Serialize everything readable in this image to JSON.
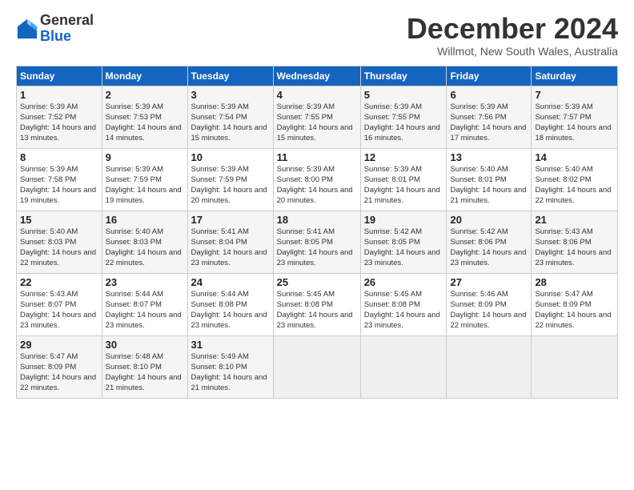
{
  "logo": {
    "general": "General",
    "blue": "Blue"
  },
  "header": {
    "title": "December 2024",
    "subtitle": "Willmot, New South Wales, Australia"
  },
  "weekdays": [
    "Sunday",
    "Monday",
    "Tuesday",
    "Wednesday",
    "Thursday",
    "Friday",
    "Saturday"
  ],
  "weeks": [
    [
      {
        "day": "1",
        "sunrise": "5:39 AM",
        "sunset": "7:52 PM",
        "daylight": "14 hours and 13 minutes."
      },
      {
        "day": "2",
        "sunrise": "5:39 AM",
        "sunset": "7:53 PM",
        "daylight": "14 hours and 14 minutes."
      },
      {
        "day": "3",
        "sunrise": "5:39 AM",
        "sunset": "7:54 PM",
        "daylight": "14 hours and 15 minutes."
      },
      {
        "day": "4",
        "sunrise": "5:39 AM",
        "sunset": "7:55 PM",
        "daylight": "14 hours and 15 minutes."
      },
      {
        "day": "5",
        "sunrise": "5:39 AM",
        "sunset": "7:55 PM",
        "daylight": "14 hours and 16 minutes."
      },
      {
        "day": "6",
        "sunrise": "5:39 AM",
        "sunset": "7:56 PM",
        "daylight": "14 hours and 17 minutes."
      },
      {
        "day": "7",
        "sunrise": "5:39 AM",
        "sunset": "7:57 PM",
        "daylight": "14 hours and 18 minutes."
      }
    ],
    [
      {
        "day": "8",
        "sunrise": "5:39 AM",
        "sunset": "7:58 PM",
        "daylight": "14 hours and 19 minutes."
      },
      {
        "day": "9",
        "sunrise": "5:39 AM",
        "sunset": "7:59 PM",
        "daylight": "14 hours and 19 minutes."
      },
      {
        "day": "10",
        "sunrise": "5:39 AM",
        "sunset": "7:59 PM",
        "daylight": "14 hours and 20 minutes."
      },
      {
        "day": "11",
        "sunrise": "5:39 AM",
        "sunset": "8:00 PM",
        "daylight": "14 hours and 20 minutes."
      },
      {
        "day": "12",
        "sunrise": "5:39 AM",
        "sunset": "8:01 PM",
        "daylight": "14 hours and 21 minutes."
      },
      {
        "day": "13",
        "sunrise": "5:40 AM",
        "sunset": "8:01 PM",
        "daylight": "14 hours and 21 minutes."
      },
      {
        "day": "14",
        "sunrise": "5:40 AM",
        "sunset": "8:02 PM",
        "daylight": "14 hours and 22 minutes."
      }
    ],
    [
      {
        "day": "15",
        "sunrise": "5:40 AM",
        "sunset": "8:03 PM",
        "daylight": "14 hours and 22 minutes."
      },
      {
        "day": "16",
        "sunrise": "5:40 AM",
        "sunset": "8:03 PM",
        "daylight": "14 hours and 22 minutes."
      },
      {
        "day": "17",
        "sunrise": "5:41 AM",
        "sunset": "8:04 PM",
        "daylight": "14 hours and 23 minutes."
      },
      {
        "day": "18",
        "sunrise": "5:41 AM",
        "sunset": "8:05 PM",
        "daylight": "14 hours and 23 minutes."
      },
      {
        "day": "19",
        "sunrise": "5:42 AM",
        "sunset": "8:05 PM",
        "daylight": "14 hours and 23 minutes."
      },
      {
        "day": "20",
        "sunrise": "5:42 AM",
        "sunset": "8:06 PM",
        "daylight": "14 hours and 23 minutes."
      },
      {
        "day": "21",
        "sunrise": "5:43 AM",
        "sunset": "8:06 PM",
        "daylight": "14 hours and 23 minutes."
      }
    ],
    [
      {
        "day": "22",
        "sunrise": "5:43 AM",
        "sunset": "8:07 PM",
        "daylight": "14 hours and 23 minutes."
      },
      {
        "day": "23",
        "sunrise": "5:44 AM",
        "sunset": "8:07 PM",
        "daylight": "14 hours and 23 minutes."
      },
      {
        "day": "24",
        "sunrise": "5:44 AM",
        "sunset": "8:08 PM",
        "daylight": "14 hours and 23 minutes."
      },
      {
        "day": "25",
        "sunrise": "5:45 AM",
        "sunset": "8:08 PM",
        "daylight": "14 hours and 23 minutes."
      },
      {
        "day": "26",
        "sunrise": "5:45 AM",
        "sunset": "8:08 PM",
        "daylight": "14 hours and 23 minutes."
      },
      {
        "day": "27",
        "sunrise": "5:46 AM",
        "sunset": "8:09 PM",
        "daylight": "14 hours and 22 minutes."
      },
      {
        "day": "28",
        "sunrise": "5:47 AM",
        "sunset": "8:09 PM",
        "daylight": "14 hours and 22 minutes."
      }
    ],
    [
      {
        "day": "29",
        "sunrise": "5:47 AM",
        "sunset": "8:09 PM",
        "daylight": "14 hours and 22 minutes."
      },
      {
        "day": "30",
        "sunrise": "5:48 AM",
        "sunset": "8:10 PM",
        "daylight": "14 hours and 21 minutes."
      },
      {
        "day": "31",
        "sunrise": "5:49 AM",
        "sunset": "8:10 PM",
        "daylight": "14 hours and 21 minutes."
      },
      null,
      null,
      null,
      null
    ]
  ]
}
